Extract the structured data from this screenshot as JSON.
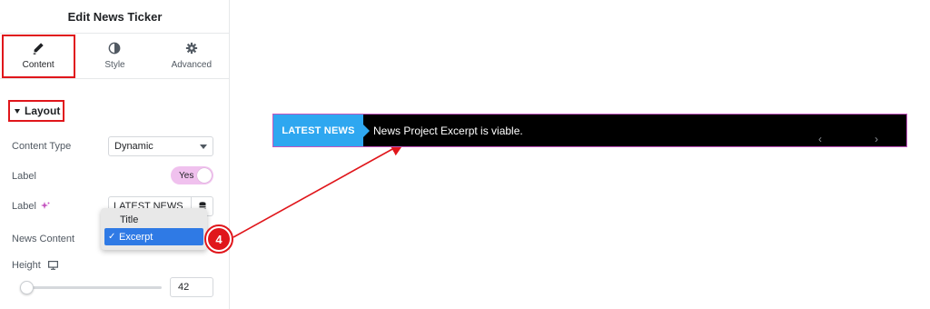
{
  "panel": {
    "title": "Edit News Ticker",
    "tabs": [
      {
        "label": "Content",
        "icon": "pencil-icon",
        "active": true
      },
      {
        "label": "Style",
        "icon": "contrast-icon",
        "active": false
      },
      {
        "label": "Advanced",
        "icon": "gear-icon",
        "active": false
      }
    ],
    "section": "Layout",
    "content_type": {
      "label": "Content Type",
      "value": "Dynamic"
    },
    "label_toggle": {
      "label": "Label",
      "value": "Yes"
    },
    "label_text": {
      "label": "Label",
      "value": "LATEST NEWS",
      "icon": "ai-sparkle-icon"
    },
    "news_content": {
      "label": "News Content",
      "options": [
        "Title",
        "Excerpt"
      ],
      "selected": "Excerpt"
    },
    "height": {
      "label": "Height",
      "value": "42",
      "icon": "desktop-icon"
    }
  },
  "step_marker": "4",
  "ticker": {
    "label": "LATEST NEWS",
    "text": "News Project Excerpt is viable.",
    "prev": "‹",
    "next": "›"
  },
  "colors": {
    "accent_red": "#e0161b",
    "ticker_blue": "#2ea7f0",
    "ticker_border": "#c455c0",
    "toggle_pink": "#f0c1ee",
    "selected_blue": "#2f7ae5"
  }
}
